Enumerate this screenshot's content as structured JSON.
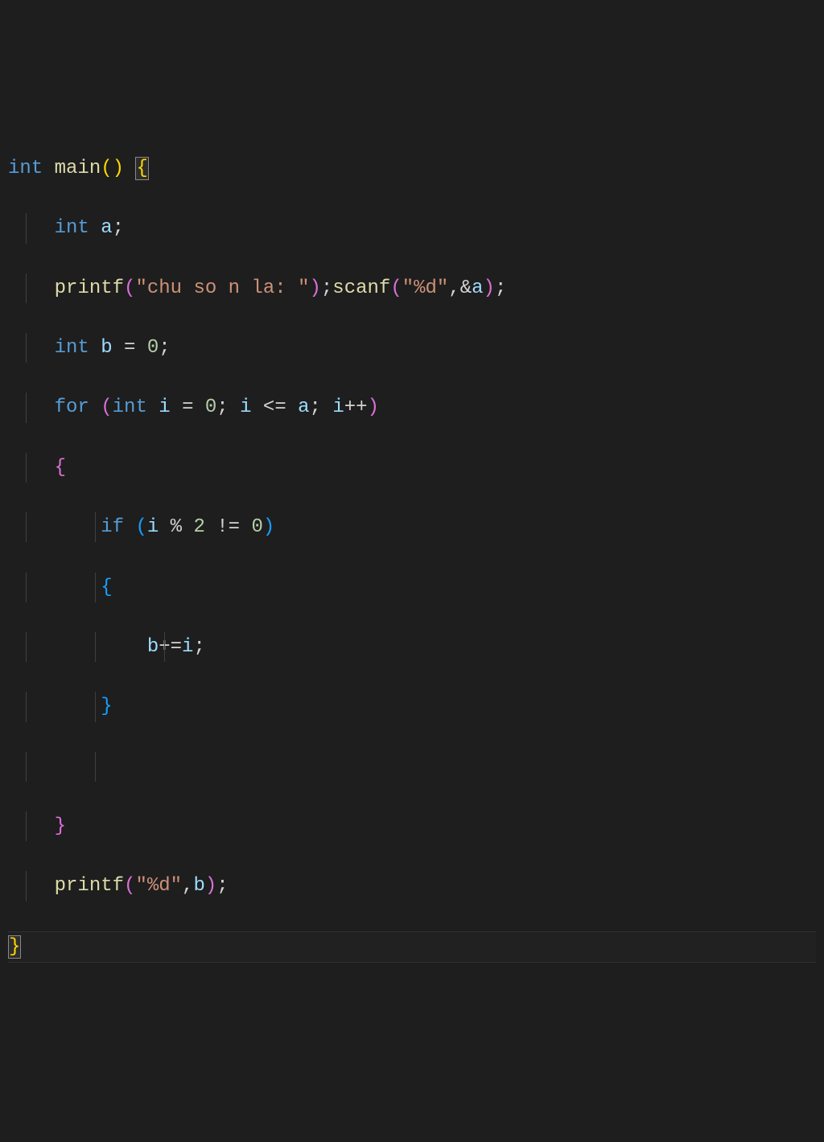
{
  "code": {
    "l1": {
      "int": "int",
      "main": "main",
      "paren_open": "(",
      "paren_close": ")",
      "brace_open": "{"
    },
    "l2": {
      "int": "int",
      "a": "a",
      "semi": ";"
    },
    "l3": {
      "printf": "printf",
      "paren_open1": "(",
      "str1": "\"chu so n la: \"",
      "paren_close1": ")",
      "semi1": ";",
      "scanf": "scanf",
      "paren_open2": "(",
      "str2": "\"%d\"",
      "comma": ",",
      "amp": "&",
      "a": "a",
      "paren_close2": ")",
      "semi2": ";"
    },
    "l4": {
      "int": "int",
      "b": "b",
      "eq": " = ",
      "zero": "0",
      "semi": ";"
    },
    "l5": {
      "for": "for",
      "paren_open": "(",
      "int": "int",
      "i": "i",
      "eq": " = ",
      "zero": "0",
      "semi1": ";",
      "i2": "i",
      "lte": " <= ",
      "a": "a",
      "semi2": ";",
      "i3": "i",
      "inc": "++",
      "paren_close": ")"
    },
    "l6": {
      "brace_open": "{"
    },
    "l7": {
      "if": "if",
      "paren_open": "(",
      "i": "i",
      "mod": " % ",
      "two": "2",
      "neq": " != ",
      "zero": "0",
      "paren_close": ")"
    },
    "l8": {
      "brace_open": "{"
    },
    "l9": {
      "b": "b",
      "pluseq": "+=",
      "i": "i",
      "semi": ";"
    },
    "l10": {
      "brace_close": "}"
    },
    "l11": {
      "empty": " "
    },
    "l12": {
      "brace_close": "}"
    },
    "l13": {
      "printf": "printf",
      "paren_open": "(",
      "str": "\"%d\"",
      "comma": ",",
      "b": "b",
      "paren_close": ")",
      "semi": ";"
    },
    "l14": {
      "brace_close": "}"
    }
  }
}
